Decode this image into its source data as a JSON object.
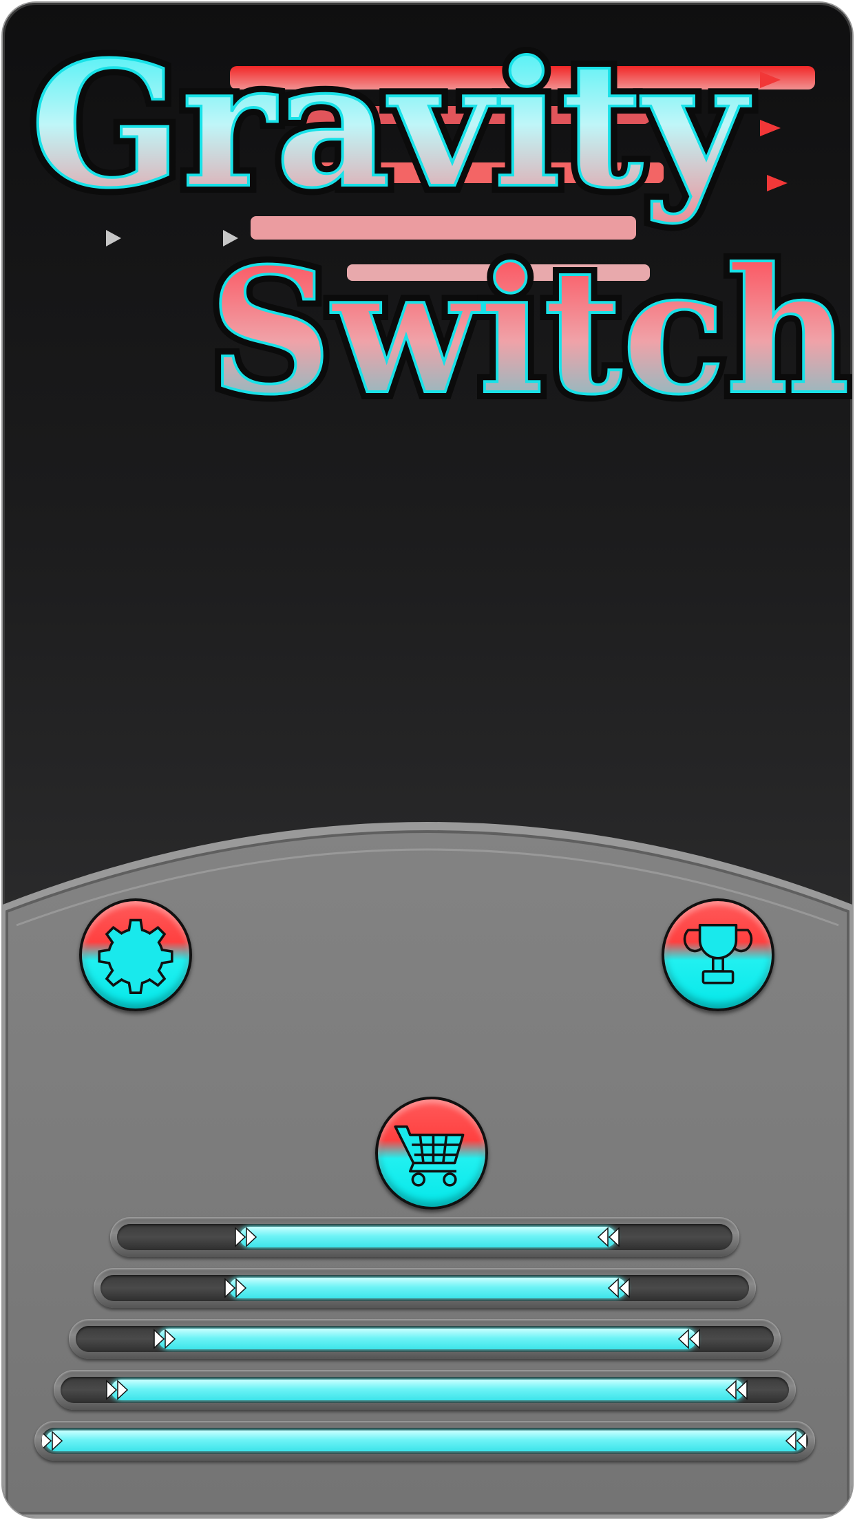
{
  "title": {
    "line1": "Gravity",
    "line2": "Switch"
  },
  "menu": {
    "settings_icon": "gear-icon",
    "leaderboard_icon": "trophy-icon",
    "shop_icon": "shopping-cart-icon"
  },
  "level_bars": [
    {
      "fill": 0.62
    },
    {
      "fill": 0.62
    },
    {
      "fill": 0.78
    },
    {
      "fill": 0.88
    },
    {
      "fill": 1.0
    }
  ],
  "colors": {
    "accent_red": "#ff4a4a",
    "accent_cyan": "#19e9ec",
    "panel_grey": "#7b7b7b",
    "background_dark": "#1a1a1a"
  }
}
